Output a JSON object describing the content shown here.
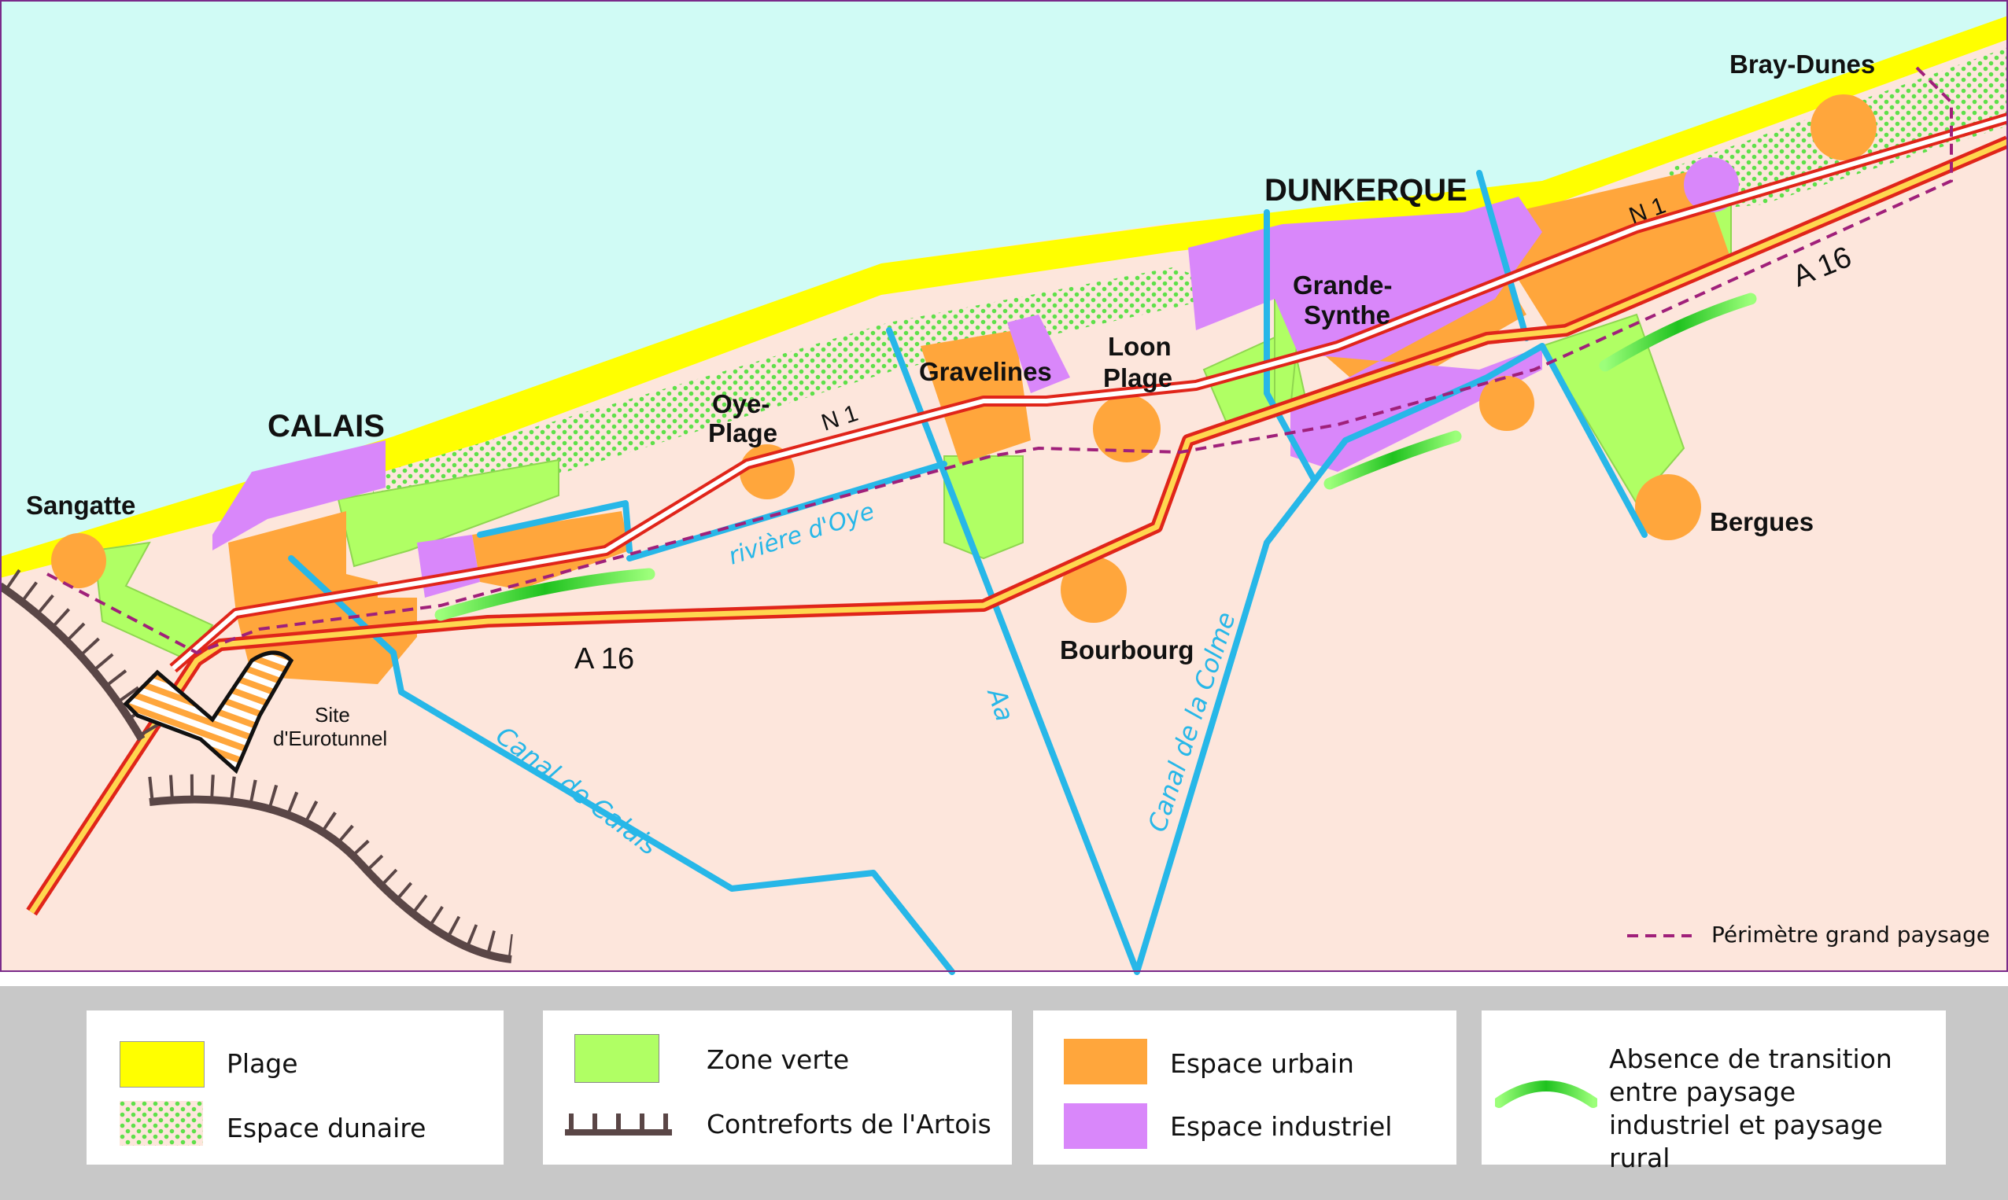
{
  "places": {
    "calais": "CALAIS",
    "dunkerque": "DUNKERQUE",
    "sangatte": "Sangatte",
    "oye_plage_1": "Oye-",
    "oye_plage_2": "Plage",
    "gravelines": "Gravelines",
    "loon_plage_1": "Loon",
    "loon_plage_2": "Plage",
    "grande_synthe_1": "Grande-",
    "grande_synthe_2": "Synthe",
    "bray_dunes": "Bray-Dunes",
    "bergues": "Bergues",
    "bourbourg": "Bourbourg",
    "eurotunnel_1": "Site",
    "eurotunnel_2": "d'Eurotunnel"
  },
  "roads": {
    "n1_west": "N 1",
    "n1_east": "N 1",
    "a16_west": "A 16",
    "a16_east": "A 16"
  },
  "waterways": {
    "riviere_oye": "rivière d'Oye",
    "canal_calais": "Canal de Calais",
    "aa": "Aa",
    "canal_colme": "Canal de la Colme"
  },
  "perimeter_label": "Périmètre grand paysage",
  "legend": {
    "plage": "Plage",
    "espace_dunaire": "Espace dunaire",
    "zone_verte": "Zone verte",
    "contreforts": "Contreforts de l'Artois",
    "espace_urbain": "Espace urbain",
    "espace_industriel": "Espace industriel",
    "absence_transition": "Absence de transition entre paysage industriel et paysage rural"
  },
  "colors": {
    "sea": "#d0fbf5",
    "land": "#fde6dc",
    "beach": "#ffff00",
    "dune": "#5fe04a",
    "green_zone": "#b0ff64",
    "urban": "#ffa63c",
    "industrial": "#d987fa",
    "water": "#27b7e8",
    "road_red": "#e0251a",
    "highway_yellow": "#ffd750",
    "perimeter": "#a0207a",
    "artois": "#5a4646",
    "legend_bg": "#c8c8c8"
  }
}
